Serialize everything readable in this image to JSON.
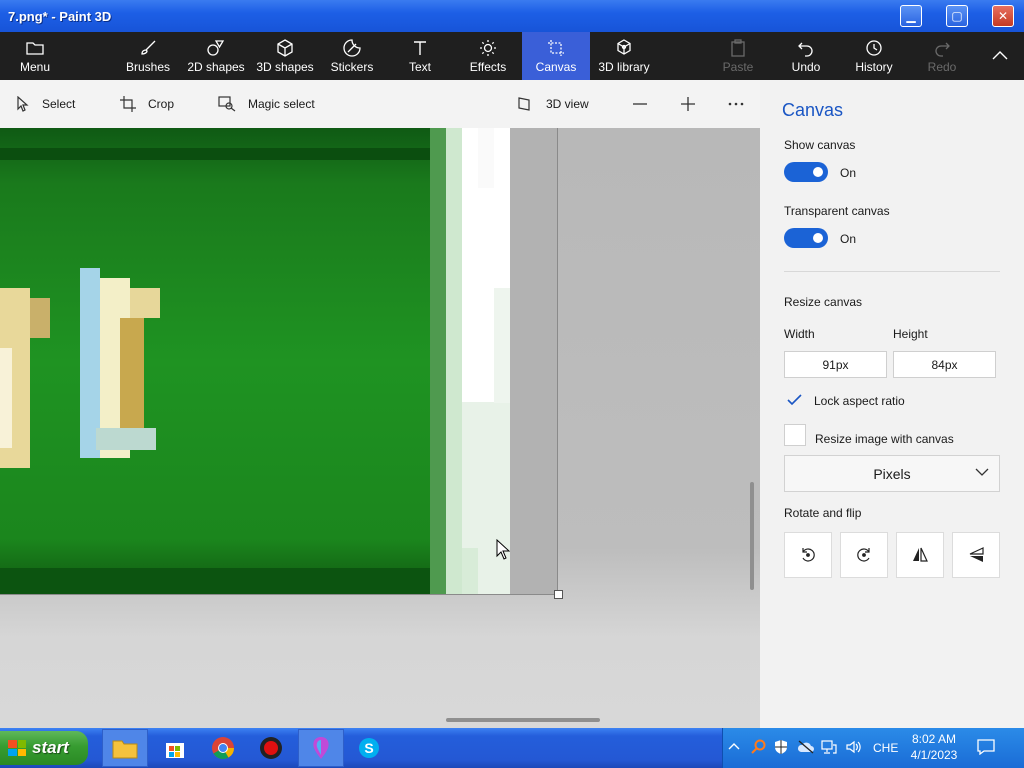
{
  "window": {
    "title": "7.png* - Paint 3D"
  },
  "toolbar": {
    "menu": "Menu",
    "brushes": "Brushes",
    "shapes2d": "2D shapes",
    "shapes3d": "3D shapes",
    "stickers": "Stickers",
    "text": "Text",
    "effects": "Effects",
    "canvas": "Canvas",
    "library3d": "3D library",
    "paste": "Paste",
    "undo": "Undo",
    "history": "History",
    "redo": "Redo"
  },
  "subbar": {
    "select": "Select",
    "crop": "Crop",
    "magic_select": "Magic select",
    "view3d": "3D view"
  },
  "panel": {
    "title": "Canvas",
    "show_canvas": "Show canvas",
    "show_canvas_state": "On",
    "transparent_canvas": "Transparent canvas",
    "transparent_canvas_state": "On",
    "resize_canvas": "Resize canvas",
    "width_label": "Width",
    "height_label": "Height",
    "width_value": "91px",
    "height_value": "84px",
    "lock_aspect": "Lock aspect ratio",
    "resize_image": "Resize image with canvas",
    "unit": "Pixels",
    "rotate_flip": "Rotate and flip"
  },
  "taskbar": {
    "start": "start",
    "language": "CHE",
    "time": "8:02 AM",
    "date": "4/1/2023"
  },
  "colors": {
    "accent": "#3a5fd8",
    "toggle_on": "#1b63d6",
    "toolbar_bg": "#1f1f1f",
    "image_green": "#1f8f1f"
  }
}
